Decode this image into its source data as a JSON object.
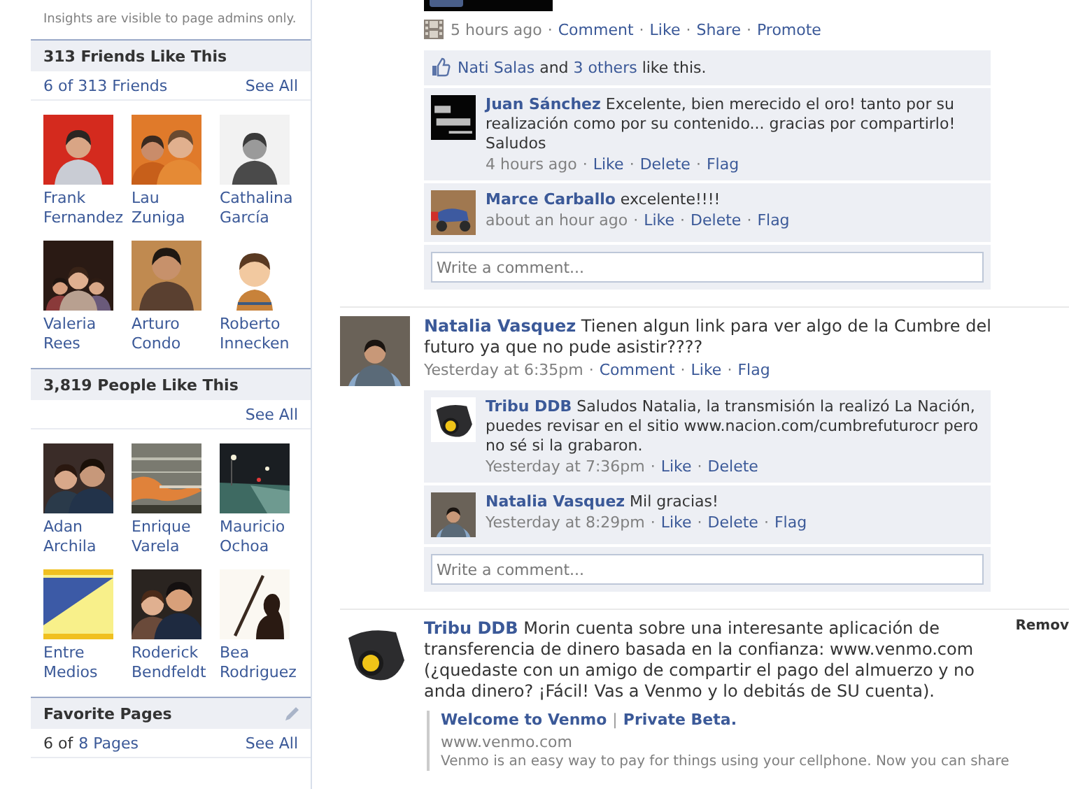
{
  "separator": "·",
  "sidebar": {
    "insights_note": "Insights are visible to page admins only.",
    "sections": [
      {
        "kind": "friends",
        "title": "313 Friends Like This",
        "count": "6 of 313 Friends",
        "see_all": "See All",
        "people": [
          {
            "first": "Frank",
            "last": "Fernandez"
          },
          {
            "first": "Lau",
            "last": "Zuniga"
          },
          {
            "first": "Cathalina",
            "last": "García"
          },
          {
            "first": "Valeria",
            "last": "Rees"
          },
          {
            "first": "Arturo",
            "last": "Condo"
          },
          {
            "first": "Roberto",
            "last": "Innecken"
          }
        ]
      },
      {
        "kind": "people",
        "title": "3,819 People Like This",
        "see_all": "See All",
        "people": [
          {
            "first": "Adan",
            "last": "Archila"
          },
          {
            "first": "Enrique",
            "last": "Varela"
          },
          {
            "first": "Mauricio",
            "last": "Ochoa"
          },
          {
            "first": "Entre",
            "last": "Medios"
          },
          {
            "first": "Roderick",
            "last": "Bendfeldt"
          },
          {
            "first": "Bea",
            "last": "Rodriguez"
          }
        ]
      },
      {
        "kind": "pages",
        "title": "Favorite Pages",
        "count_prefix": "6 of",
        "count_link": "8 Pages",
        "see_all": "See All"
      }
    ]
  },
  "feed": [
    {
      "kind": "video",
      "time": "5 hours ago",
      "actions": [
        "Comment",
        "Like",
        "Share",
        "Promote"
      ],
      "likes": {
        "names": "Nati Salas",
        "joiner": "and",
        "others": "3 others",
        "suffix": "like this."
      },
      "comments": [
        {
          "author": "Juan Sánchez",
          "text": "Excelente, bien merecido el oro! tanto por su realización como por su contenido... gracias por compartirlo! Saludos",
          "time": "4 hours ago",
          "actions": [
            "Like",
            "Delete",
            "Flag"
          ]
        },
        {
          "author": "Marce Carballo",
          "text": "excelente!!!!",
          "time": "about an hour ago",
          "actions": [
            "Like",
            "Delete",
            "Flag"
          ]
        }
      ],
      "comment_placeholder": "Write a comment..."
    },
    {
      "kind": "status",
      "author": "Natalia Vasquez",
      "text": "Tienen algun link para ver algo de la Cumbre del futuro ya que no pude asistir????",
      "time": "Yesterday at 6:35pm",
      "actions": [
        "Comment",
        "Like",
        "Flag"
      ],
      "comments": [
        {
          "author": "Tribu DDB",
          "text": "Saludos Natalia, la transmisión la realizó La Nación, puedes revisar en el sitio www.nacion.com/cumbrefuturocr pero no sé si la grabaron.",
          "time": "Yesterday at 7:36pm",
          "actions": [
            "Like",
            "Delete"
          ]
        },
        {
          "author": "Natalia Vasquez",
          "text": "Mil gracias!",
          "time": "Yesterday at 8:29pm",
          "actions": [
            "Like",
            "Delete",
            "Flag"
          ]
        }
      ],
      "comment_placeholder": "Write a comment..."
    },
    {
      "kind": "status",
      "author": "Tribu DDB",
      "text": "Morin cuenta sobre una interesante aplicación de transferencia de dinero basada en la confianza: www.venmo.com (¿quedaste con un amigo de compartir el pago del almuerzo y no anda dinero? ¡Fácil! Vas a Venmo y lo debitás de SU cuenta).",
      "remove": "Remov",
      "link": {
        "title": "Welcome to Venmo",
        "separator": "|",
        "title2": "Private Beta.",
        "domain": "www.venmo.com",
        "description": "Venmo is an easy way to pay for things using your cellphone. Now you can share"
      }
    }
  ]
}
